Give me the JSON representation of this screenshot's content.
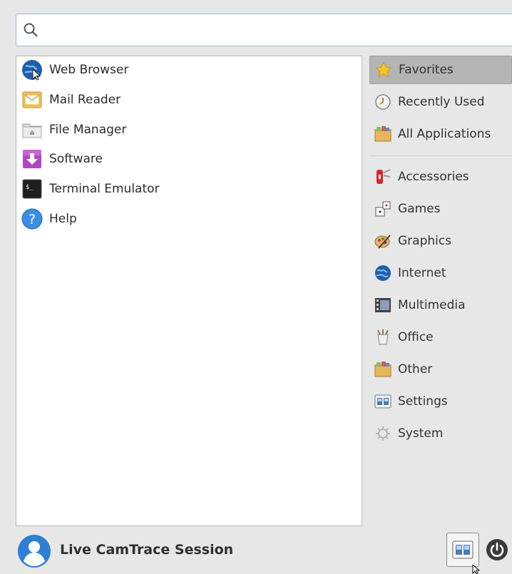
{
  "search": {
    "placeholder": "",
    "value": ""
  },
  "favorites": [
    {
      "label": "Web Browser",
      "icon": "web-browser-icon"
    },
    {
      "label": "Mail Reader",
      "icon": "mail-icon"
    },
    {
      "label": "File Manager",
      "icon": "folder-icon"
    },
    {
      "label": "Software",
      "icon": "software-icon"
    },
    {
      "label": "Terminal Emulator",
      "icon": "terminal-icon"
    },
    {
      "label": "Help",
      "icon": "help-icon"
    }
  ],
  "categories": [
    {
      "label": "Favorites",
      "icon": "star-icon",
      "active": true
    },
    {
      "label": "Recently Used",
      "icon": "clock-icon"
    },
    {
      "label": "All Applications",
      "icon": "all-apps-icon"
    },
    {
      "label": "Accessories",
      "icon": "accessories-icon"
    },
    {
      "label": "Games",
      "icon": "games-icon"
    },
    {
      "label": "Graphics",
      "icon": "graphics-icon"
    },
    {
      "label": "Internet",
      "icon": "internet-icon"
    },
    {
      "label": "Multimedia",
      "icon": "multimedia-icon"
    },
    {
      "label": "Office",
      "icon": "office-icon"
    },
    {
      "label": "Other",
      "icon": "other-icon"
    },
    {
      "label": "Settings",
      "icon": "settings-icon"
    },
    {
      "label": "System",
      "icon": "system-icon"
    }
  ],
  "footer": {
    "user_name": "Live CamTrace Session"
  },
  "colors": {
    "active_category_bg": "#b4b4b4",
    "search_border": "#9fb4d2",
    "accent_blue": "#2f7fd4"
  }
}
